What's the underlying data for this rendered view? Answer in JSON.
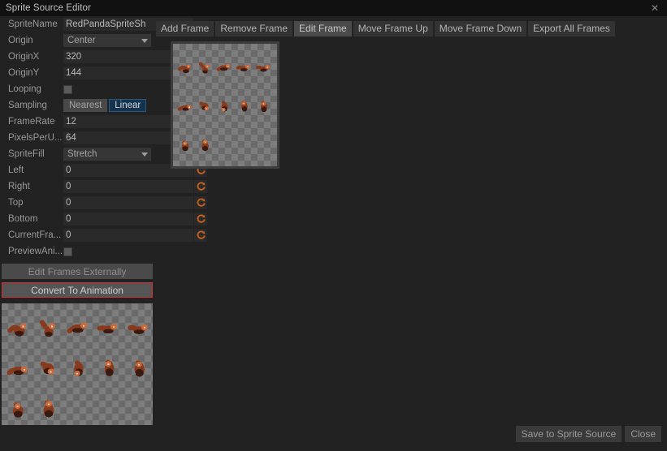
{
  "window": {
    "title": "Sprite Source Editor",
    "close_icon": "close-icon",
    "close_glyph": "✕",
    "background": "#222222",
    "titlebar_background": "#111111"
  },
  "properties": [
    {
      "label": "SpriteName",
      "control": "text",
      "value": "RedPandaSpriteSh",
      "reset": false
    },
    {
      "label": "Origin",
      "control": "combo",
      "value": "Center",
      "reset": false
    },
    {
      "label": "OriginX",
      "control": "text",
      "value": "320",
      "reset": true
    },
    {
      "label": "OriginY",
      "control": "text",
      "value": "144",
      "reset": true
    },
    {
      "label": "Looping",
      "control": "checkbox",
      "value": "",
      "checked": false,
      "reset": false
    },
    {
      "label": "Sampling",
      "control": "toggle",
      "value": "Linear",
      "options": [
        "Nearest",
        "Linear"
      ],
      "reset": false
    },
    {
      "label": "FrameRate",
      "control": "text",
      "value": "12",
      "reset": true
    },
    {
      "label": "PixelsPerU...",
      "control": "text",
      "value": "64",
      "reset": true
    },
    {
      "label": "SpriteFill",
      "control": "combo",
      "value": "Stretch",
      "reset": false
    },
    {
      "label": "Left",
      "control": "text",
      "value": "0",
      "reset": true
    },
    {
      "label": "Right",
      "control": "text",
      "value": "0",
      "reset": true
    },
    {
      "label": "Top",
      "control": "text",
      "value": "0",
      "reset": true
    },
    {
      "label": "Bottom",
      "control": "text",
      "value": "0",
      "reset": true
    },
    {
      "label": "CurrentFra...",
      "control": "text",
      "value": "0",
      "reset": true
    },
    {
      "label": "PreviewAni...",
      "control": "checkbox",
      "value": "",
      "checked": false,
      "reset": false
    }
  ],
  "actions": {
    "edit_frames_externally": "Edit Frames Externally",
    "convert_to_animation": "Convert To Animation",
    "highlight_color": "#d32f2f"
  },
  "toolbar": {
    "buttons": [
      {
        "label": "Add Frame",
        "active": false
      },
      {
        "label": "Remove Frame",
        "active": false
      },
      {
        "label": "Edit Frame",
        "active": true
      },
      {
        "label": "Move Frame Up",
        "active": false
      },
      {
        "label": "Move Frame Down",
        "active": false
      },
      {
        "label": "Export All Frames",
        "active": false
      }
    ]
  },
  "footer": {
    "save_label": "Save to Sprite Source",
    "close_label": "Close"
  },
  "sprite_sheet": {
    "name": "RedPandaSpriteSheet",
    "frame_count": 12,
    "columns": 5,
    "rows": 3,
    "last_row_count": 2,
    "body_color": "#8a3a1c",
    "dark_color": "#3a1a10",
    "accent_color": "#c96b3a",
    "checker_light": "#7d7d7d",
    "checker_dark": "#6a6a6a"
  }
}
